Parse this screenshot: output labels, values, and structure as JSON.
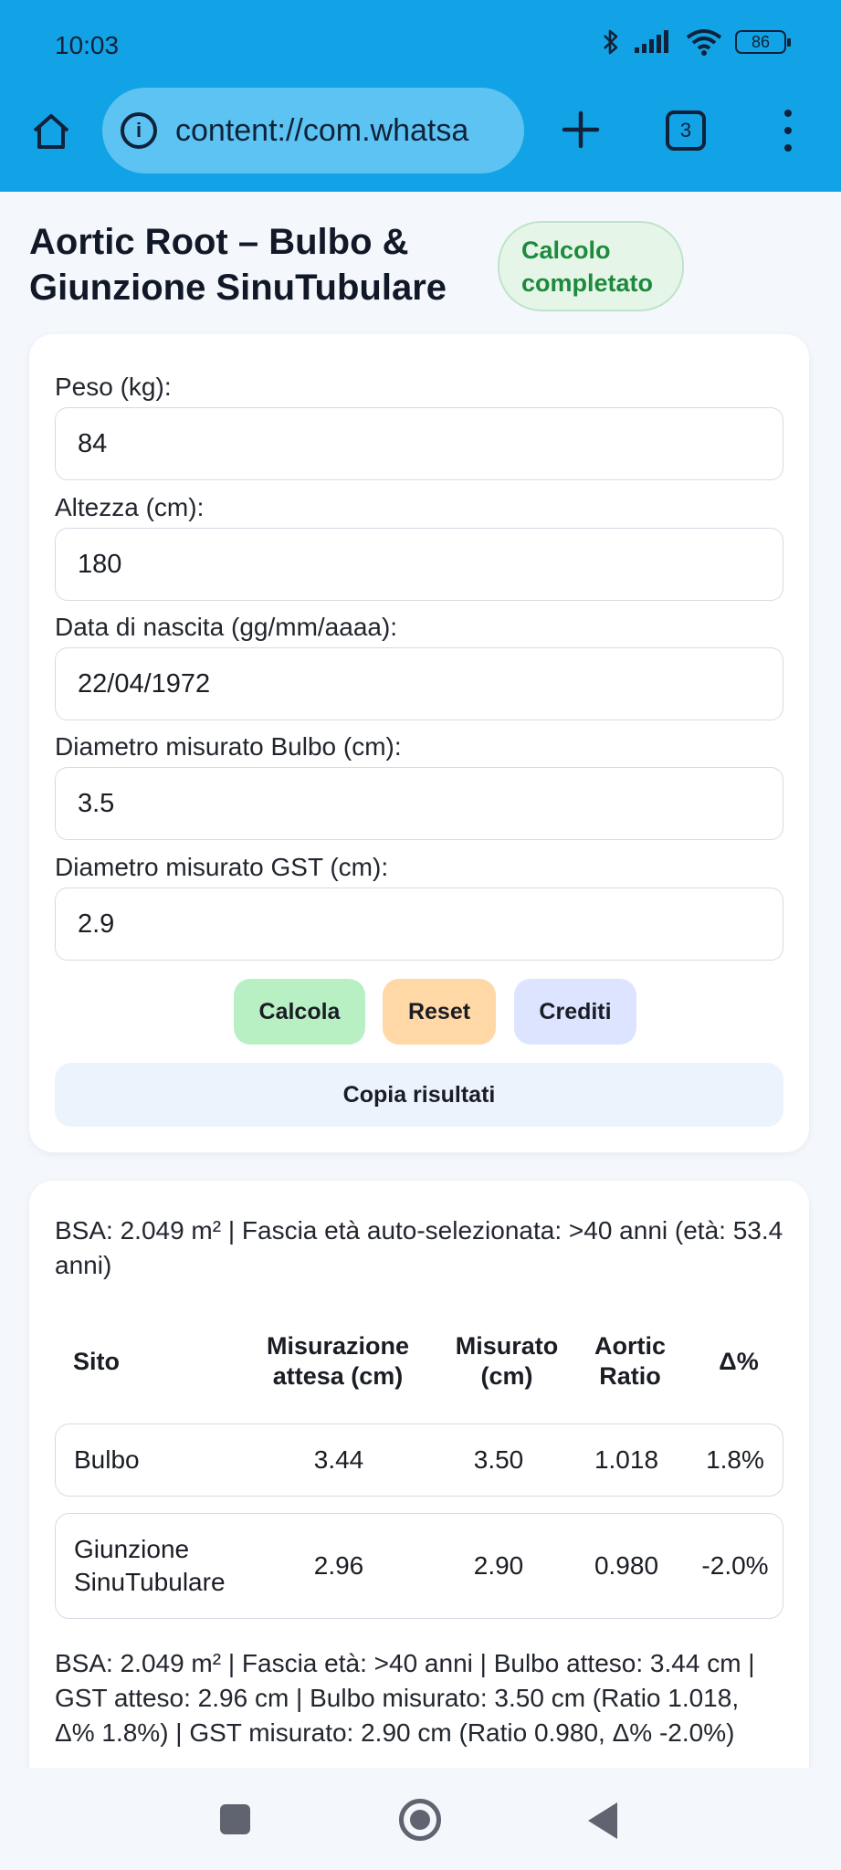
{
  "status_bar": {
    "time": "10:03",
    "battery": "86"
  },
  "browser": {
    "url": "content://com.whatsa",
    "tab_count": "3"
  },
  "page": {
    "title": "Aortic Root – Bulbo & Giunzione SinuTubulare",
    "status_badge": "Calcolo completato"
  },
  "form": {
    "fields": [
      {
        "label": "Peso (kg):",
        "value": "84"
      },
      {
        "label": "Altezza (cm):",
        "value": "180"
      },
      {
        "label": "Data di nascita (gg/mm/aaaa):",
        "value": "22/04/1972"
      },
      {
        "label": "Diametro misurato Bulbo (cm):",
        "value": "3.5"
      },
      {
        "label": "Diametro misurato GST (cm):",
        "value": "2.9"
      }
    ],
    "buttons": {
      "calc": "Calcola",
      "reset": "Reset",
      "credits": "Crediti",
      "copy": "Copia risultati"
    }
  },
  "results": {
    "bsa_line": "BSA: 2.049 m² | Fascia età auto-selezionata: >40 anni (età: 53.4 anni)",
    "columns": [
      "Sito",
      "Misurazione attesa (cm)",
      "Misurato (cm)",
      "Aortic Ratio",
      "Δ%"
    ],
    "rows": [
      {
        "site": "Bulbo",
        "expected": "3.44",
        "measured": "3.50",
        "ratio": "1.018",
        "delta": "1.8%"
      },
      {
        "site": "Giunzione SinuTubulare",
        "expected": "2.96",
        "measured": "2.90",
        "ratio": "0.980",
        "delta": "-2.0%"
      }
    ],
    "summary": "BSA: 2.049 m² | Fascia età: >40 anni | Bulbo atteso: 3.44 cm | GST atteso: 2.96 cm | Bulbo misurato: 3.50 cm (Ratio 1.018, Δ% 1.8%) | GST misurato: 2.90 cm (Ratio 0.980, Δ% -2.0%)"
  },
  "colors": {
    "chrome": "#12a3e6",
    "badge_text": "#1d8a3c",
    "calc_button": "#b8f0c4",
    "reset_button": "#ffd8a6",
    "credits_button": "#dde4ff"
  },
  "icons": [
    "home-icon",
    "info-icon",
    "plus-icon",
    "tabs-icon",
    "more-vert-icon",
    "bluetooth-icon",
    "signal-icon",
    "wifi-icon",
    "battery-icon"
  ]
}
